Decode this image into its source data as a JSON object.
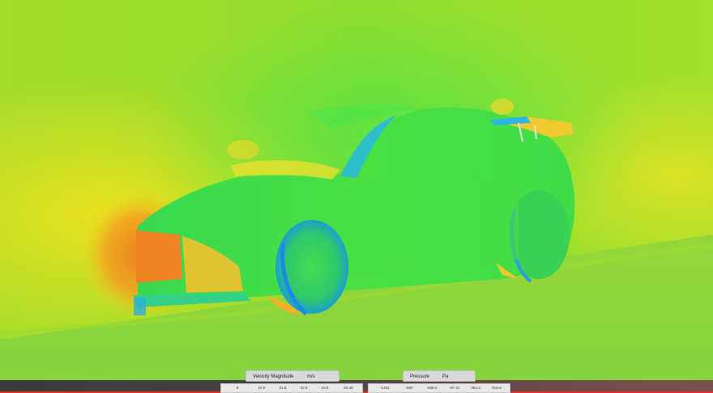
{
  "colors": {
    "background_field": "#9cdc2c",
    "car_body": "#44e040",
    "high_pressure": "#f07a20",
    "low_velocity": "#2a9cf0",
    "ground": "#8ad43c"
  },
  "legends": {
    "velocity": {
      "title": "Velocity Magnitude",
      "unit": "m/s",
      "ticks": [
        "0",
        "10.9",
        "21.8",
        "32.6",
        "43.5",
        "54.35"
      ]
    },
    "pressure": {
      "title": "Pressure",
      "unit": "Pa",
      "ticks": [
        "-1441",
        "-990",
        "-538.5",
        "-87.21",
        "364.2",
        "815.6"
      ]
    }
  }
}
